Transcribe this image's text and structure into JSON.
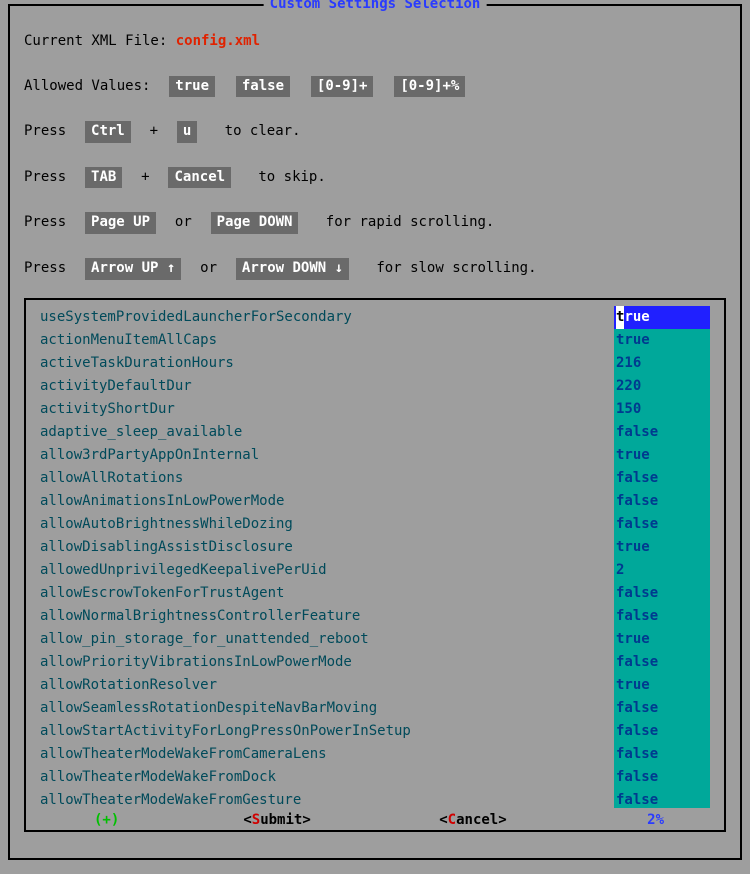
{
  "title": "Custom Settings Selection",
  "current_xml_label": "Current XML File: ",
  "current_xml_file": "config.xml",
  "allowed_values_label": "Allowed Values:",
  "allowed_values": [
    "true",
    "false",
    "[0-9]+",
    "[0-9]+%"
  ],
  "hints": {
    "clear_prefix": "Press ",
    "clear_keys": [
      "Ctrl",
      "u"
    ],
    "clear_suffix": "  to clear.",
    "skip_prefix": "Press ",
    "skip_keys": [
      "TAB",
      "Cancel"
    ],
    "skip_suffix": "  to skip.",
    "rapid_prefix": "Press ",
    "rapid_keys": [
      "Page UP",
      "Page DOWN"
    ],
    "rapid_join": " or ",
    "rapid_suffix": "  for rapid scrolling.",
    "slow_prefix": "Press ",
    "slow_keys": [
      "Arrow UP ↑",
      "Arrow DOWN ↓"
    ],
    "slow_join": " or ",
    "slow_suffix": "  for slow scrolling.",
    "plus_join": " + "
  },
  "settings": [
    {
      "name": "useSystemProvidedLauncherForSecondary",
      "value": "true"
    },
    {
      "name": "actionMenuItemAllCaps",
      "value": "true"
    },
    {
      "name": "activeTaskDurationHours",
      "value": "216"
    },
    {
      "name": "activityDefaultDur",
      "value": "220"
    },
    {
      "name": "activityShortDur",
      "value": "150"
    },
    {
      "name": "adaptive_sleep_available",
      "value": "false"
    },
    {
      "name": "allow3rdPartyAppOnInternal",
      "value": "true"
    },
    {
      "name": "allowAllRotations",
      "value": "false"
    },
    {
      "name": "allowAnimationsInLowPowerMode",
      "value": "false"
    },
    {
      "name": "allowAutoBrightnessWhileDozing",
      "value": "false"
    },
    {
      "name": "allowDisablingAssistDisclosure",
      "value": "true"
    },
    {
      "name": "allowedUnprivilegedKeepalivePerUid",
      "value": "2"
    },
    {
      "name": "allowEscrowTokenForTrustAgent",
      "value": "false"
    },
    {
      "name": "allowNormalBrightnessControllerFeature",
      "value": "false"
    },
    {
      "name": "allow_pin_storage_for_unattended_reboot",
      "value": "true"
    },
    {
      "name": "allowPriorityVibrationsInLowPowerMode",
      "value": "false"
    },
    {
      "name": "allowRotationResolver",
      "value": "true"
    },
    {
      "name": "allowSeamlessRotationDespiteNavBarMoving",
      "value": "false"
    },
    {
      "name": "allowStartActivityForLongPressOnPowerInSetup",
      "value": "false"
    },
    {
      "name": "allowTheaterModeWakeFromCameraLens",
      "value": "false"
    },
    {
      "name": "allowTheaterModeWakeFromDock",
      "value": "false"
    },
    {
      "name": "allowTheaterModeWakeFromGesture",
      "value": "false"
    }
  ],
  "selected_index": 0,
  "footer": {
    "plus": "(+)",
    "submit_bracket_l": "<",
    "submit_hot": "S",
    "submit_rest": "ubmit",
    "submit_bracket_r": ">",
    "cancel_bracket_l": "<",
    "cancel_hot": "C",
    "cancel_rest": "ancel",
    "cancel_bracket_r": ">",
    "percent": "2%"
  }
}
